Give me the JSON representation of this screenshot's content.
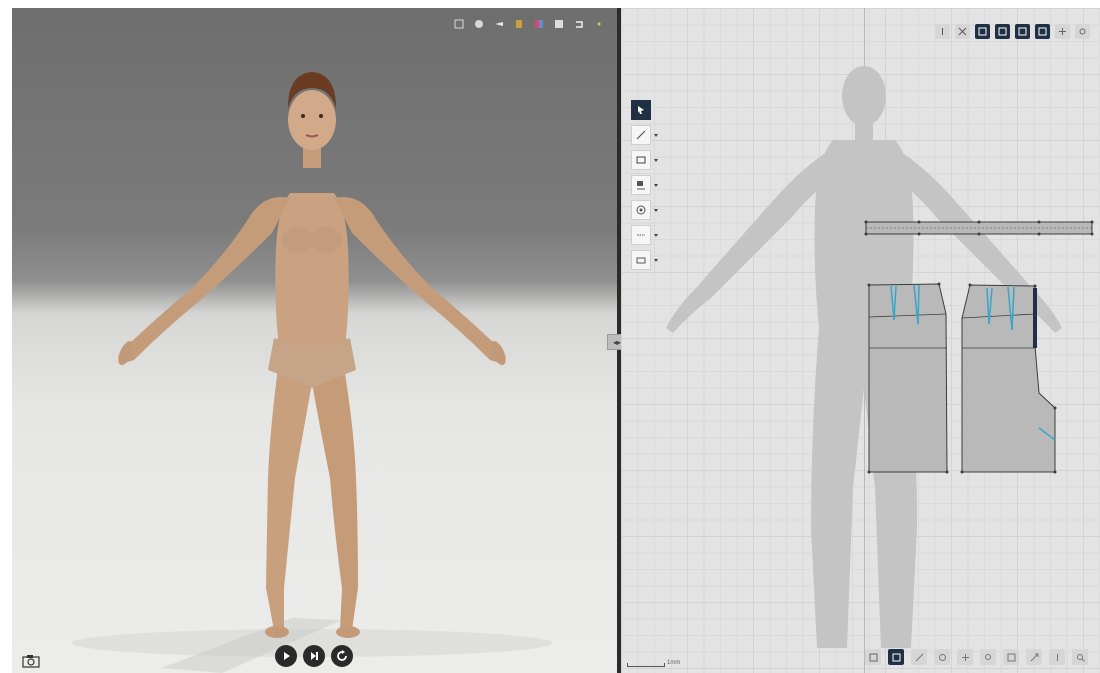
{
  "viewport3d": {
    "toolbar_icons": [
      "select-icon",
      "display-icon",
      "avatar-icon",
      "texture-icon",
      "color-icon",
      "layer-icon",
      "undo-icon",
      "more-icon"
    ],
    "playback": [
      "play-icon",
      "step-forward-icon",
      "reset-icon"
    ],
    "camera_icon": "camera-icon"
  },
  "pattern2d": {
    "toolbar_icons": [
      "pin-icon",
      "cut-icon",
      "view-a-icon",
      "view-b-icon",
      "view-c-icon",
      "view-d-icon",
      "grid-icon",
      "settings-icon"
    ],
    "tools": [
      {
        "icon": "select-arrow-icon",
        "active": true
      },
      {
        "icon": "pen-icon",
        "active": false
      },
      {
        "icon": "rectangle-icon",
        "active": false
      },
      {
        "icon": "sewing-icon",
        "active": false
      },
      {
        "icon": "button-icon",
        "active": false
      },
      {
        "icon": "topstitch-icon",
        "active": false
      },
      {
        "icon": "fold-icon",
        "active": false
      }
    ],
    "bottom_icons": [
      "layout-icon",
      "select-icon",
      "transform-icon",
      "reset-icon",
      "pan-icon",
      "zoom-icon",
      "fit-icon",
      "expand-icon",
      "flip-icon",
      "search-icon"
    ],
    "scale_label": "1mm"
  },
  "colors": {
    "accent": "#1f2f44",
    "seam": "#3aa6c9",
    "pattern_fill": "#b9b9b9"
  }
}
